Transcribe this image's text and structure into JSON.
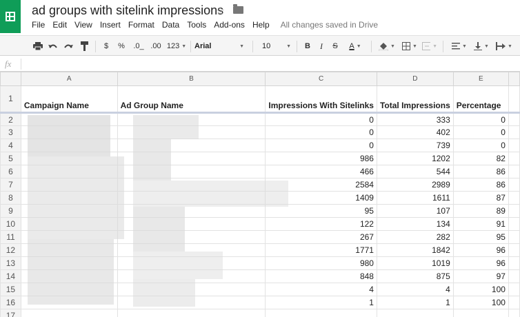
{
  "document": {
    "title": "ad groups with sitelink impressions",
    "save_status": "All changes saved in Drive",
    "menu": [
      "File",
      "Edit",
      "View",
      "Insert",
      "Format",
      "Data",
      "Tools",
      "Add-ons",
      "Help"
    ]
  },
  "toolbar": {
    "currency": "$",
    "percent": "%",
    "decrease_decimals": ".0_",
    "increase_decimals": ".00",
    "more_formats": "123",
    "font": "Arial",
    "font_size": "10",
    "bold": "B",
    "italic": "I",
    "strikethrough": "S",
    "text_color": "A"
  },
  "formula_bar": {
    "label": "fx",
    "value": ""
  },
  "sheet": {
    "columns": [
      "A",
      "B",
      "C",
      "D",
      "E"
    ],
    "headers": [
      "Campaign Name",
      "Ad Group Name",
      "Impressions With Sitelinks",
      "Total Impressions",
      "Percentage"
    ],
    "rows": [
      {
        "n": "2",
        "c": "0",
        "d": "333",
        "e": "0"
      },
      {
        "n": "3",
        "c": "0",
        "d": "402",
        "e": "0"
      },
      {
        "n": "4",
        "c": "0",
        "d": "739",
        "e": "0"
      },
      {
        "n": "5",
        "c": "986",
        "d": "1202",
        "e": "82"
      },
      {
        "n": "6",
        "c": "466",
        "d": "544",
        "e": "86"
      },
      {
        "n": "7",
        "c": "2584",
        "d": "2989",
        "e": "86"
      },
      {
        "n": "8",
        "c": "1409",
        "d": "1611",
        "e": "87"
      },
      {
        "n": "9",
        "c": "95",
        "d": "107",
        "e": "89"
      },
      {
        "n": "10",
        "c": "122",
        "d": "134",
        "e": "91"
      },
      {
        "n": "11",
        "c": "267",
        "d": "282",
        "e": "95"
      },
      {
        "n": "12",
        "c": "1771",
        "d": "1842",
        "e": "96"
      },
      {
        "n": "13",
        "c": "980",
        "d": "1019",
        "e": "96"
      },
      {
        "n": "14",
        "c": "848",
        "d": "875",
        "e": "97"
      },
      {
        "n": "15",
        "c": "4",
        "d": "4",
        "e": "100"
      },
      {
        "n": "16",
        "c": "1",
        "d": "1",
        "e": "100"
      },
      {
        "n": "17",
        "c": "",
        "d": "",
        "e": ""
      }
    ]
  },
  "icons": {
    "app": "sheets-icon",
    "star": "star-icon",
    "folder": "folder-icon",
    "print": "print-icon",
    "undo": "undo-icon",
    "redo": "redo-icon",
    "paint": "paint-format-icon",
    "fill": "fill-color-icon",
    "borders": "borders-icon",
    "merge": "merge-icon",
    "halign": "align-left-icon",
    "valign": "align-bottom-icon",
    "wrap": "text-wrap-icon"
  },
  "colors": {
    "brand": "#0f9d58",
    "header_bg": "#f3f3f3"
  }
}
